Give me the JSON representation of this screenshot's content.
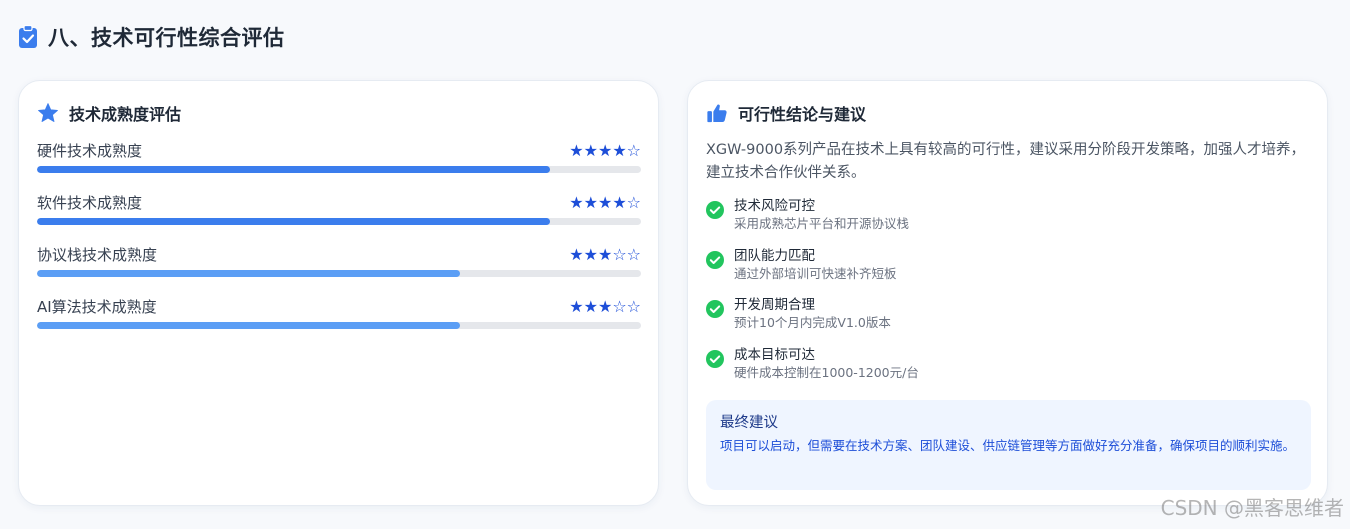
{
  "header": {
    "title": "八、技术可行性综合评估",
    "icon": "clipboard-check-icon"
  },
  "maturity": {
    "title": "技术成熟度评估",
    "icon": "star-icon",
    "items": [
      {
        "label": "硬件技术成熟度",
        "stars": "★★★★☆",
        "rating": 4,
        "max": 5,
        "progress": 0.85,
        "color": "#3b7ded"
      },
      {
        "label": "软件技术成熟度",
        "stars": "★★★★☆",
        "rating": 4,
        "max": 5,
        "progress": 0.85,
        "color": "#3b7ded"
      },
      {
        "label": "协议栈技术成熟度",
        "stars": "★★★☆☆",
        "rating": 3,
        "max": 5,
        "progress": 0.7,
        "color": "#5b9ef5"
      },
      {
        "label": "AI算法技术成熟度",
        "stars": "★★★☆☆",
        "rating": 3,
        "max": 5,
        "progress": 0.7,
        "color": "#5b9ef5"
      }
    ]
  },
  "conclusion": {
    "title": "可行性结论与建议",
    "icon": "thumbs-up-icon",
    "summary": "XGW-9000系列产品在技术上具有较高的可行性，建议采用分阶段开发策略，加强人才培养，建立技术合作伙伴关系。",
    "checks": [
      {
        "title": "技术风险可控",
        "desc": "采用成熟芯片平台和开源协议栈"
      },
      {
        "title": "团队能力匹配",
        "desc": "通过外部培训可快速补齐短板"
      },
      {
        "title": "开发周期合理",
        "desc": "预计10个月内完成V1.0版本"
      },
      {
        "title": "成本目标可达",
        "desc": "硬件成本控制在1000-1200元/台"
      }
    ],
    "final": {
      "title": "最终建议",
      "text": "项目可以启动，但需要在技术方案、团队建设、供应链管理等方面做好充分准备，确保项目的顺利实施。"
    }
  },
  "watermark": "CSDN @黑客思维者",
  "colors": {
    "accent": "#3b7ded",
    "success": "#22c55e",
    "star": "#1d4ed8"
  }
}
